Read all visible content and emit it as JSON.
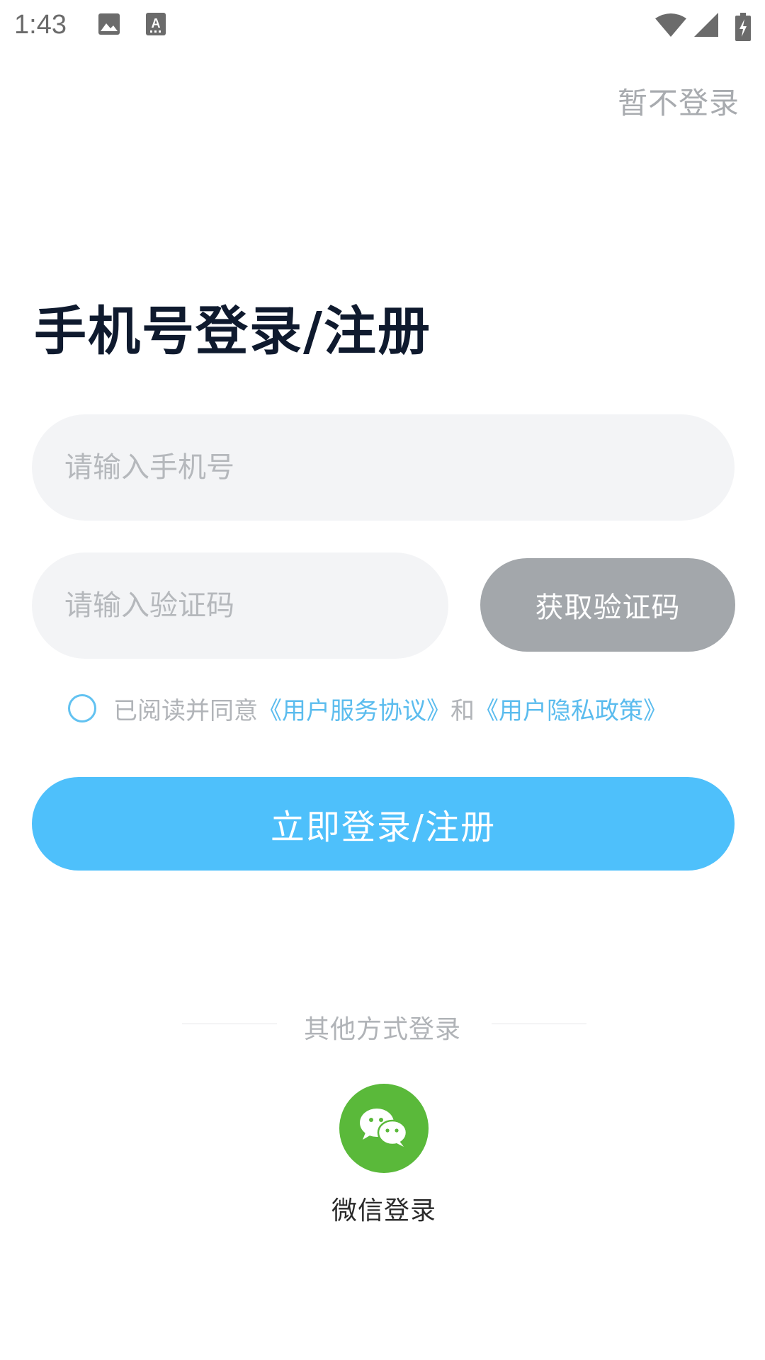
{
  "status_bar": {
    "time": "1:43",
    "icons": [
      "image-icon",
      "text-a-icon",
      "wifi-icon",
      "signal-icon",
      "battery-charging-icon"
    ]
  },
  "header": {
    "skip_label": "暂不登录"
  },
  "title": "手机号登录/注册",
  "form": {
    "phone_placeholder": "请输入手机号",
    "phone_value": "",
    "code_placeholder": "请输入验证码",
    "code_value": "",
    "get_code_label": "获取验证码"
  },
  "agreement": {
    "prefix": "已阅读并同意",
    "service_link": "《用户服务协议》",
    "conjunction": "和",
    "privacy_link": "《用户隐私政策》",
    "checked": false
  },
  "login_button_label": "立即登录/注册",
  "other_methods": {
    "label": "其他方式登录",
    "wechat_label": "微信登录"
  },
  "colors": {
    "primary": "#4ec0fb",
    "link": "#5bbcee",
    "disabled_button": "#a3a7ab",
    "input_bg": "#f3f4f6",
    "wechat_green": "#5ab93a",
    "title": "#0f1a2e"
  }
}
